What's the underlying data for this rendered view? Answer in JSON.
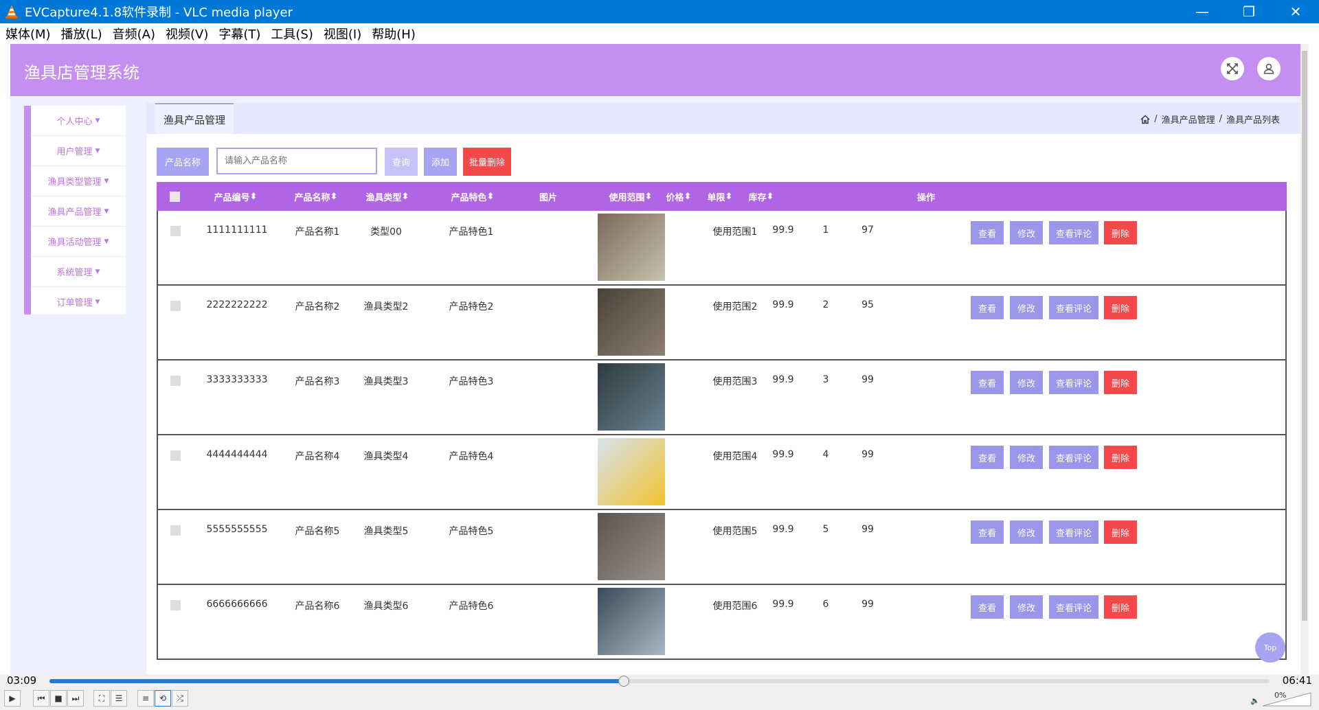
{
  "window": {
    "title": "EVCapture4.1.8软件录制 - VLC media player"
  },
  "menubar": [
    "媒体(M)",
    "播放(L)",
    "音频(A)",
    "视频(V)",
    "字幕(T)",
    "工具(S)",
    "视图(I)",
    "帮助(H)"
  ],
  "app": {
    "title": "渔具店管理系统"
  },
  "sidebar": {
    "items": [
      "个人中心",
      "用户管理",
      "渔具类型管理",
      "渔具产品管理",
      "渔具活动管理",
      "系统管理",
      "订单管理"
    ]
  },
  "breadcrumb": {
    "tab": "渔具产品管理",
    "path": [
      "渔具产品管理",
      "渔具产品列表"
    ]
  },
  "search": {
    "label": "产品名称",
    "placeholder": "请输入产品名称",
    "query_btn": "查询",
    "add_btn": "添加",
    "batch_delete_btn": "批量删除"
  },
  "table": {
    "headers": {
      "code": "产品编号",
      "name": "产品名称",
      "type": "渔具类型",
      "feature": "产品特色",
      "image": "图片",
      "scope": "使用范围",
      "price": "价格",
      "limit": "单限",
      "stock": "库存",
      "ops": "操作"
    },
    "rows": [
      {
        "code": "1111111111",
        "name": "产品名称1",
        "type": "类型00",
        "feature": "产品特色1",
        "scope": "使用范围1",
        "price": "99.9",
        "limit": "1",
        "stock": "97"
      },
      {
        "code": "2222222222",
        "name": "产品名称2",
        "type": "渔具类型2",
        "feature": "产品特色2",
        "scope": "使用范围2",
        "price": "99.9",
        "limit": "2",
        "stock": "95"
      },
      {
        "code": "3333333333",
        "name": "产品名称3",
        "type": "渔具类型3",
        "feature": "产品特色3",
        "scope": "使用范围3",
        "price": "99.9",
        "limit": "3",
        "stock": "99"
      },
      {
        "code": "4444444444",
        "name": "产品名称4",
        "type": "渔具类型4",
        "feature": "产品特色4",
        "scope": "使用范围4",
        "price": "99.9",
        "limit": "4",
        "stock": "99"
      },
      {
        "code": "5555555555",
        "name": "产品名称5",
        "type": "渔具类型5",
        "feature": "产品特色5",
        "scope": "使用范围5",
        "price": "99.9",
        "limit": "5",
        "stock": "99"
      },
      {
        "code": "6666666666",
        "name": "产品名称6",
        "type": "渔具类型6",
        "feature": "产品特色6",
        "scope": "使用范围6",
        "price": "99.9",
        "limit": "6",
        "stock": "99"
      }
    ],
    "actions": {
      "view": "查看",
      "edit": "修改",
      "comments": "查看评论",
      "delete": "删除"
    }
  },
  "top_button": "Top",
  "player": {
    "elapsed": "03:09",
    "total": "06:41",
    "progress": 0.47,
    "volume": "0%"
  },
  "colors": {
    "accent": "#c58ff2",
    "header": "#b065e6",
    "button": "#a8a4f4",
    "danger": "#f5484a",
    "titlebar": "#0078d7"
  }
}
